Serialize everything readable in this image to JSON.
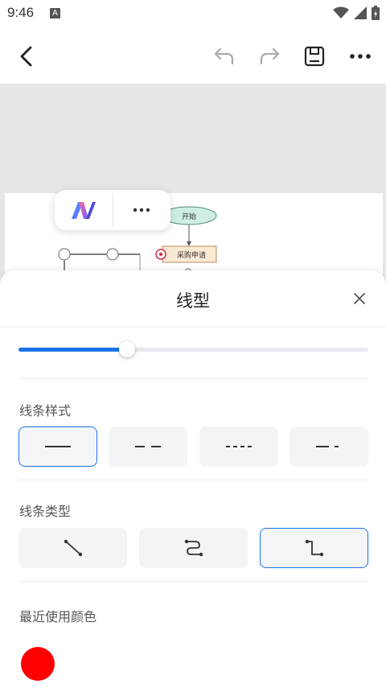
{
  "status": {
    "time": "9:46",
    "app_icon": "A"
  },
  "toolbar": {
    "back_icon": "arrow-left-icon",
    "undo_icon": "undo-icon",
    "redo_icon": "redo-icon",
    "save_icon": "save-icon",
    "more_icon": "more-horizontal-icon"
  },
  "canvas": {
    "nodes": {
      "start": "开始",
      "purchase": "采购申请"
    }
  },
  "float_toolbar": {
    "logo_icon": "app-logo-icon",
    "more_icon": "more-horizontal-icon"
  },
  "panel": {
    "title": "线型",
    "close_icon": "close-icon",
    "line_width_value": 0.31,
    "line_style_label": "线条样式",
    "line_styles": [
      "solid",
      "dashed",
      "dotted",
      "dash-dot"
    ],
    "selected_line_style": 0,
    "line_type_label": "线条类型",
    "line_types": [
      "straight",
      "curved",
      "elbow"
    ],
    "selected_line_type": 2,
    "recent_colors_label": "最近使用颜色",
    "recent_colors": [
      "#ff0000"
    ]
  },
  "colors": {
    "accent": "#1a73e8",
    "recent_red": "#ff0000"
  }
}
